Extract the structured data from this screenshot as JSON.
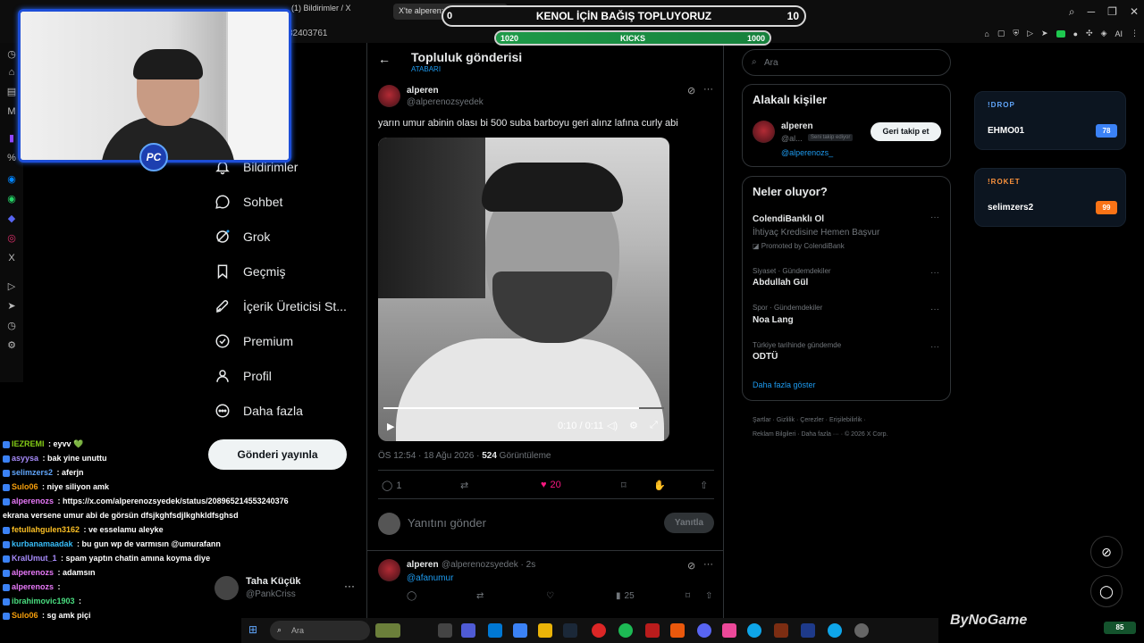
{
  "browser": {
    "tabs": [
      "(1) Bildirimler / X",
      "X'te alperen: \"yarın"
    ],
    "url_fragment": "32403761",
    "win_min": "─",
    "win_max": "❐",
    "win_close": "✕",
    "ext_ai": "AI"
  },
  "donation": {
    "left_value": "0",
    "title": "KENOL İÇİN BAĞIŞ TOPLUYORUZ",
    "right_value": "10",
    "kicks_left": "1020",
    "kicks_title": "KICKS",
    "kicks_right": "1000",
    "kicks_progress": 1.0
  },
  "nav": {
    "items": [
      {
        "label": "Bildirimler",
        "icon": "bell-icon"
      },
      {
        "label": "Sohbet",
        "icon": "chat-icon"
      },
      {
        "label": "Grok",
        "icon": "grok-icon"
      },
      {
        "label": "Geçmiş",
        "icon": "bookmark-icon"
      },
      {
        "label": "İçerik Üreticisi St...",
        "icon": "rocket-icon"
      },
      {
        "label": "Premium",
        "icon": "verified-icon"
      },
      {
        "label": "Profil",
        "icon": "person-icon"
      },
      {
        "label": "Daha fazla",
        "icon": "more-circle-icon"
      }
    ],
    "post_button": "Gönderi yayınla"
  },
  "profile": {
    "name": "Taha Küçük",
    "handle": "@PankCriss",
    "more": "···"
  },
  "main": {
    "back": "←",
    "title": "Topluluk gönderisi",
    "subtitle": "ATABARI",
    "post": {
      "name": "alperen",
      "handle": "@alperenozsyedek",
      "text": "yarın umur abinin olası bi 500 suba barboyu geri alınz lafına curly abi",
      "video_time": "0:10 / 0:11",
      "video_progress": 0.91,
      "timestamp": "ÖS 12:54 · 18 Ağu 2026 · ",
      "views": "524",
      "views_label": " Görüntüleme",
      "replies": "1",
      "likes": "20",
      "more": "···"
    },
    "reply_placeholder": "Yanıtını gönder",
    "reply_button": "Yanıtla",
    "reply2": {
      "name": "alperen",
      "handle": "@alperenozsyedek · 2s",
      "mention": "@afanumur",
      "views": "25",
      "more": "···"
    }
  },
  "search": {
    "placeholder": "Ara"
  },
  "people": {
    "title": "Alakalı kişiler",
    "name": "alperen",
    "handle": "@al...",
    "badge": "Seni takip ediyor",
    "link": "@alperenozs_",
    "follow": "Geri takip et"
  },
  "trends": {
    "title": "Neler oluyor?",
    "items": [
      {
        "context": "",
        "name": "ColendiBanklı Ol",
        "desc": "İhtiyaç Kredisine Hemen Başvur",
        "promo": "Promoted by ColendiBank"
      },
      {
        "context": "Siyaset · Gündemdekiler",
        "name": "Abdullah Gül"
      },
      {
        "context": "Spor · Gündemdekiler",
        "name": "Noa Lang"
      },
      {
        "context": "Türkiye tarihinde gündemde",
        "name": "ODTÜ"
      }
    ],
    "more_dots": "···",
    "show_more": "Daha fazla göster"
  },
  "footer": {
    "line1": "Şartlar · Gizlilik · Çerezler · Erişilebilirlik ·",
    "line2": "Reklam Bilgileri · Daha fazla ··· · © 2026 X Corp."
  },
  "widgets": {
    "drop": {
      "title": "!DROP",
      "name": "EHMO01",
      "value": "78",
      "color": "#3b82f6"
    },
    "roket": {
      "title": "!ROKET",
      "name": "selimzers2",
      "value": "99",
      "color": "#f97316"
    }
  },
  "chat": [
    {
      "user": "IEZREMI",
      "msg": " : eyvv 💚",
      "color": "#84cc16"
    },
    {
      "user": "asyysa",
      "msg": " : bak yine unuttu",
      "color": "#a78bfa"
    },
    {
      "user": "selimzers2",
      "msg": " : aferjn",
      "color": "#60a5fa"
    },
    {
      "user": "Sulo06",
      "msg": " : niye siliyon amk",
      "color": "#f59e0b"
    },
    {
      "user": "alperenozs",
      "msg": " : https://x.com/alperenozsyedek/status/208965214553240376",
      "color": "#e879f9"
    },
    {
      "user": "",
      "msg": "ekrana versene umur abi de görsün dfsjkghfsdjlkghkldfsghsd",
      "color": "#fff"
    },
    {
      "user": "fetullahgulen3162",
      "msg": " : ve esselamu aleyke",
      "color": "#fbbf24"
    },
    {
      "user": "kurbanamaadak",
      "msg": " : bu gun wp de varmısın @umurafann",
      "color": "#38bdf8"
    },
    {
      "user": "KralUmut_1",
      "msg": " : spam yaptın chatin amına koyma diye",
      "color": "#a78bfa"
    },
    {
      "user": "alperenozs",
      "msg": " : adamsın",
      "color": "#e879f9"
    },
    {
      "user": "alperenozs",
      "msg": " :",
      "color": "#e879f9"
    },
    {
      "user": "ibrahimovic1903",
      "msg": " :",
      "color": "#4ade80"
    },
    {
      "user": "Sulo06",
      "msg": " : sg amk piçi",
      "color": "#f59e0b"
    }
  ],
  "taskbar": {
    "search": "Ara",
    "brand": "ByNoGame",
    "tray": "85"
  }
}
